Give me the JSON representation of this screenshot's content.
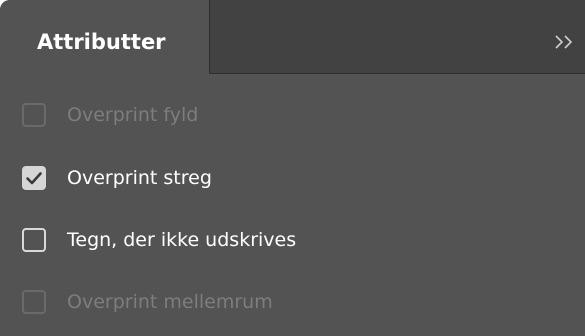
{
  "panel": {
    "tab_label": "Attributter",
    "collapse_icon": "double-chevron-right-icon"
  },
  "options": [
    {
      "label": "Overprint fyld",
      "checked": false,
      "enabled": false
    },
    {
      "label": "Overprint streg",
      "checked": true,
      "enabled": true
    },
    {
      "label": "Tegn, der ikke udskrives",
      "checked": false,
      "enabled": true
    },
    {
      "label": "Overprint mellemrum",
      "checked": false,
      "enabled": false
    }
  ],
  "colors": {
    "panel_bg": "#535353",
    "tabbar_bg": "#424242",
    "text": "#ffffff",
    "disabled_text": "#7d7d7d"
  }
}
